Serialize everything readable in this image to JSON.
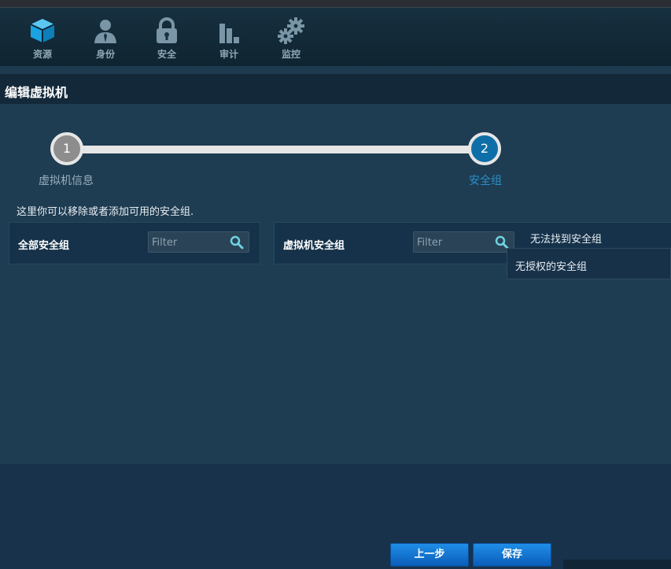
{
  "nav": {
    "items": [
      {
        "label": "资源",
        "icon": "cube-icon"
      },
      {
        "label": "身份",
        "icon": "user-icon"
      },
      {
        "label": "安全",
        "icon": "lock-icon"
      },
      {
        "label": "审计",
        "icon": "bar-chart-icon"
      },
      {
        "label": "监控",
        "icon": "gears-icon"
      }
    ]
  },
  "page": {
    "title": "编辑虚拟机"
  },
  "wizard": {
    "steps": [
      {
        "number": "1",
        "label": "虚拟机信息",
        "state": "completed"
      },
      {
        "number": "2",
        "label": "安全组",
        "state": "active"
      }
    ]
  },
  "hint": "这里你可以移除或者添加可用的安全组.",
  "panels": {
    "all_groups": {
      "title": "全部安全组",
      "filter_placeholder": "Filter"
    },
    "vm_groups": {
      "title": "虚拟机安全组",
      "filter_placeholder": "Filter"
    },
    "not_found": "无法找到安全组",
    "unauthorized": "无授权的安全组"
  },
  "buttons": {
    "prev": "上一步",
    "save": "保存"
  },
  "colors": {
    "accent": "#0e6fa8",
    "active_step_text": "#2c8fc7",
    "button": "#1b7fd8"
  }
}
